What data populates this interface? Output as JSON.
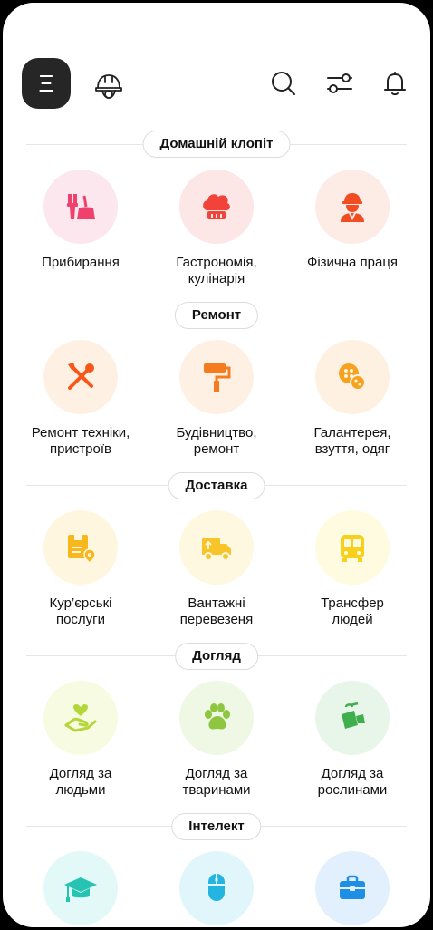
{
  "header": {
    "menu_glyph": "Ξ",
    "icons": [
      "hamburger-menu-icon",
      "worker-helmet-icon",
      "search-icon",
      "filter-icon",
      "bell-icon"
    ]
  },
  "sections": [
    {
      "title": "Домашній клопіт",
      "items": [
        {
          "label_1": "Прибирання",
          "label_2": "",
          "icon": "cleaning-icon",
          "bg": "#fde7ee",
          "color": "#f0406e"
        },
        {
          "label_1": "Гастрономія,",
          "label_2": "кулінарія",
          "icon": "chef-hat-icon",
          "bg": "#fde6e6",
          "color": "#f2433b"
        },
        {
          "label_1": "Фізична праця",
          "label_2": "",
          "icon": "worker-icon",
          "bg": "#fdebe6",
          "color": "#f24d22"
        }
      ]
    },
    {
      "title": "Ремонт",
      "items": [
        {
          "label_1": "Ремонт техніки,",
          "label_2": "пристроїв",
          "icon": "tools-icon",
          "bg": "#fff0e4",
          "color": "#f65718"
        },
        {
          "label_1": "Будівництво,",
          "label_2": "ремонт",
          "icon": "paint-roller-icon",
          "bg": "#fff0e4",
          "color": "#f57b1f"
        },
        {
          "label_1": "Галантерея,",
          "label_2": "взуття, одяг",
          "icon": "button-icon",
          "bg": "#fff1e1",
          "color": "#f5a31f"
        }
      ]
    },
    {
      "title": "Доставка",
      "items": [
        {
          "label_1": "Кур’єрські",
          "label_2": "послуги",
          "icon": "courier-package-icon",
          "bg": "#fff6df",
          "color": "#f7b81e"
        },
        {
          "label_1": "Вантажні",
          "label_2": "перевезеня",
          "icon": "truck-icon",
          "bg": "#fff8e0",
          "color": "#f8c42a"
        },
        {
          "label_1": "Трансфер",
          "label_2": "людей",
          "icon": "bus-icon",
          "bg": "#fffbe0",
          "color": "#f8cf1b"
        }
      ]
    },
    {
      "title": "Догляд",
      "items": [
        {
          "label_1": "Догляд за",
          "label_2": "людьми",
          "icon": "hand-heart-icon",
          "bg": "#f6fbe2",
          "color": "#b5d63b"
        },
        {
          "label_1": "Догляд за",
          "label_2": "тваринами",
          "icon": "paw-icon",
          "bg": "#eef8e4",
          "color": "#8fc641"
        },
        {
          "label_1": "Догляд за",
          "label_2": "рослинами",
          "icon": "watering-can-icon",
          "bg": "#e8f6ea",
          "color": "#3fae4d"
        }
      ]
    },
    {
      "title": "Інтелект",
      "items": [
        {
          "label_1": "",
          "label_2": "",
          "icon": "graduation-cap-icon",
          "bg": "#e2f9f7",
          "color": "#26c3b3"
        },
        {
          "label_1": "",
          "label_2": "",
          "icon": "mouse-icon",
          "bg": "#e1f6fb",
          "color": "#22b5e0"
        },
        {
          "label_1": "",
          "label_2": "",
          "icon": "briefcase-icon",
          "bg": "#e1f0fc",
          "color": "#1e8fe5"
        }
      ]
    }
  ]
}
